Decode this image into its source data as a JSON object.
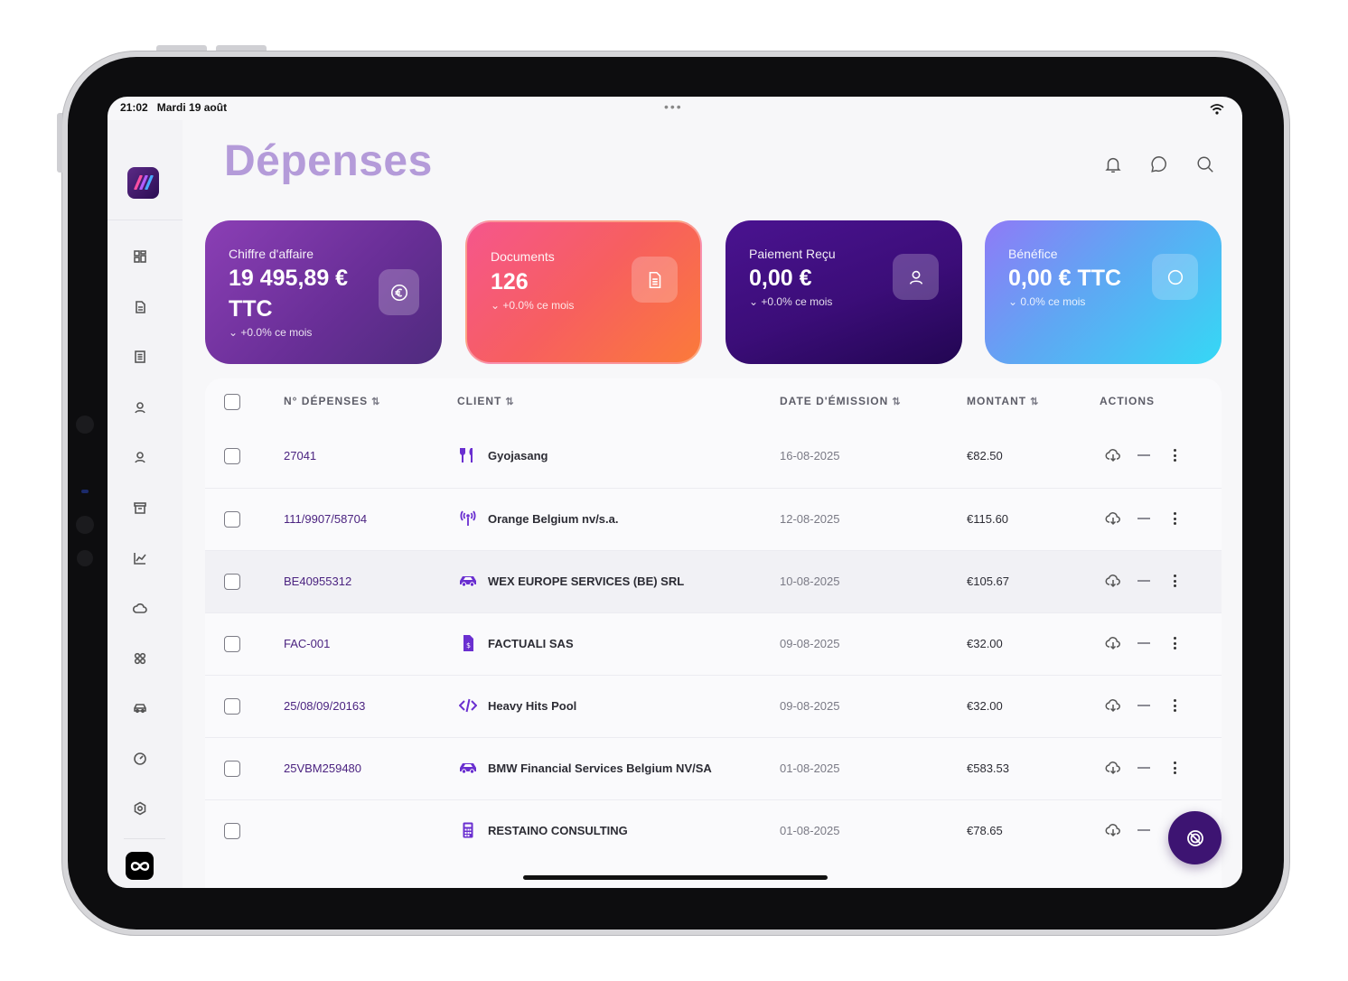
{
  "status": {
    "time": "21:02",
    "date": "Mardi 19 août"
  },
  "page": {
    "title": "Dépenses"
  },
  "nav": [
    "dashboard-icon",
    "document-icon",
    "list-icon",
    "user-icon",
    "user-alt-icon",
    "archive-icon",
    "chart-icon",
    "cloud-icon",
    "apps-icon",
    "car-icon",
    "speed-icon",
    "settings-icon"
  ],
  "cards": [
    {
      "label": "Chiffre d'affaire",
      "value_line1": "19 495,89 €",
      "value_line2": "TTC",
      "trend": "+0.0% ce mois",
      "icon": "euro-icon"
    },
    {
      "label": "Documents",
      "value_line1": "126",
      "trend": "+0.0% ce mois",
      "icon": "document-icon"
    },
    {
      "label": "Paiement Reçu",
      "value_line1": "0,00 €",
      "trend": "+0.0% ce mois",
      "icon": "user-icon"
    },
    {
      "label": "Bénéfice",
      "value_line1": "0,00 € TTC",
      "trend": "0.0% ce mois",
      "icon": "circle-icon"
    }
  ],
  "table": {
    "columns": [
      "N° DÉPENSES",
      "CLIENT",
      "DATE D'ÉMISSION",
      "MONTANT",
      "ACTIONS"
    ],
    "rows": [
      {
        "number": "27041",
        "client": "Gyojasang",
        "icon": "restaurant-icon",
        "date": "16-08-2025",
        "amount": "€82.50"
      },
      {
        "number": "111/9907/58704",
        "client": "Orange Belgium nv/s.a.",
        "icon": "antenna-icon",
        "date": "12-08-2025",
        "amount": "€115.60"
      },
      {
        "number": "BE40955312",
        "client": "WEX EUROPE SERVICES (BE) SRL",
        "icon": "car-icon",
        "date": "10-08-2025",
        "amount": "€105.67"
      },
      {
        "number": "FAC-001",
        "client": "FACTUALI SAS",
        "icon": "invoice-icon",
        "date": "09-08-2025",
        "amount": "€32.00"
      },
      {
        "number": "25/08/09/20163",
        "client": "Heavy Hits Pool",
        "icon": "code-icon",
        "date": "09-08-2025",
        "amount": "€32.00"
      },
      {
        "number": "25VBM259480",
        "client": "BMW Financial Services Belgium NV/SA",
        "icon": "car-icon",
        "date": "01-08-2025",
        "amount": "€583.53"
      },
      {
        "number": "",
        "client": "RESTAINO CONSULTING",
        "icon": "calculator-icon",
        "date": "01-08-2025",
        "amount": "€78.65"
      }
    ]
  },
  "colors": {
    "title": "#b49bd9",
    "accent": "#4b2380",
    "row_icon": "#6a2fd0"
  }
}
